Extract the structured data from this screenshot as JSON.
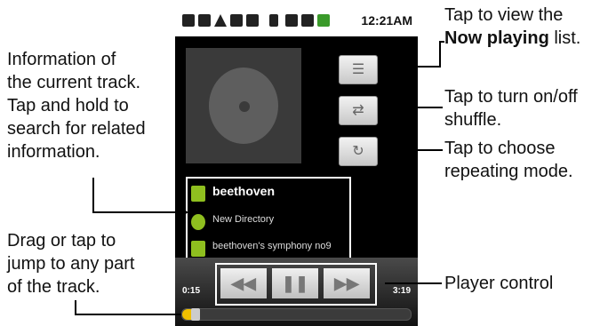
{
  "status_bar": {
    "time": "12:21AM",
    "icons": [
      "gallery-icon",
      "message-icon",
      "warning-icon",
      "usb-icon",
      "play-icon",
      "bluetooth-icon",
      "data-icon",
      "signal-icon",
      "battery-icon"
    ]
  },
  "track": {
    "artist": "beethoven",
    "album": "New Directory",
    "title": "beethoven's symphony no9"
  },
  "player": {
    "elapsed": "0:15",
    "total": "3:19",
    "progress_fraction": 0.03
  },
  "annotations": {
    "now_playing_line1": "Tap to view the",
    "now_playing_bold": "Now playing",
    "now_playing_tail": " list.",
    "shuffle_line1": "Tap to turn on/off",
    "shuffle_line2": "shuffle.",
    "repeat_line1": "Tap to choose",
    "repeat_line2": "repeating mode.",
    "info_line1": "Information of",
    "info_line2": "the current track.",
    "info_line3": "Tap and hold to",
    "info_line4": "search for related",
    "info_line5": "information.",
    "seek_line1": "Drag or tap to",
    "seek_line2": "jump to any part",
    "seek_line3": "of the track.",
    "control": "Player control"
  },
  "colors": {
    "accent_green": "#8fbf1f",
    "progress_yellow": "#f0c000"
  }
}
